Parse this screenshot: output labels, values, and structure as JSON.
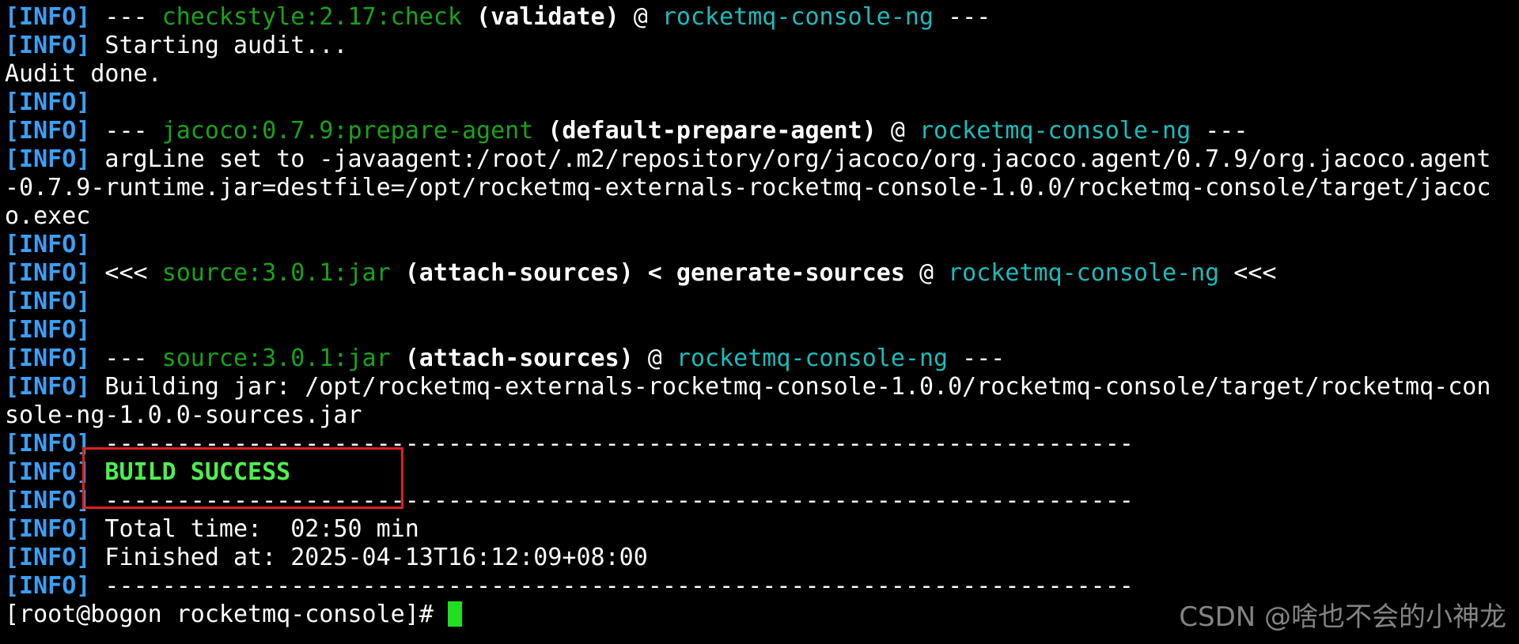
{
  "terminal": {
    "lines": [
      {
        "i": "[INFO]",
        "a": " --- ",
        "b": "checkstyle:2.17:check",
        "c": " (validate)",
        "d": " @ ",
        "e": "rocketmq-console-ng",
        "f": " ---"
      },
      {
        "i": "[INFO]",
        "t": " Starting audit..."
      },
      {
        "t": "Audit done."
      },
      {
        "i": "[INFO]"
      },
      {
        "i": "[INFO]",
        "a": " --- ",
        "b": "jacoco:0.7.9:prepare-agent",
        "c": " (default-prepare-agent)",
        "d": " @ ",
        "e": "rocketmq-console-ng",
        "f": " ---"
      },
      {
        "i": "[INFO]",
        "t": " argLine set to -javaagent:/root/.m2/repository/org/jacoco/org.jacoco.agent/0.7.9/org.jacoco.agent"
      },
      {
        "t": "-0.7.9-runtime.jar=destfile=/opt/rocketmq-externals-rocketmq-console-1.0.0/rocketmq-console/target/jacoc"
      },
      {
        "t": "o.exec"
      },
      {
        "i": "[INFO]"
      },
      {
        "i": "[INFO]",
        "a": " <<< ",
        "b": "source:3.0.1:jar",
        "c": " (attach-sources) < generate-sources",
        "d": " @ ",
        "e": "rocketmq-console-ng",
        "f": " <<<"
      },
      {
        "i": "[INFO]"
      },
      {
        "i": "[INFO]"
      },
      {
        "i": "[INFO]",
        "a": " --- ",
        "b": "source:3.0.1:jar",
        "c": " (attach-sources)",
        "d": " @ ",
        "e": "rocketmq-console-ng",
        "f": " ---"
      },
      {
        "i": "[INFO]",
        "t": " Building jar: /opt/rocketmq-externals-rocketmq-console-1.0.0/rocketmq-console/target/rocketmq-con"
      },
      {
        "t": "sole-ng-1.0.0-sources.jar"
      },
      {
        "i": "[INFO]",
        "t": " ------------------------------------------------------------------------"
      },
      {
        "i": "[INFO]",
        "s": " BUILD SUCCESS"
      },
      {
        "i": "[INFO]",
        "t": " ------------------------------------------------------------------------"
      },
      {
        "i": "[INFO]",
        "t": " Total time:  02:50 min"
      },
      {
        "i": "[INFO]",
        "t": " Finished at: 2025-04-13T16:12:09+08:00"
      },
      {
        "i": "[INFO]",
        "t": " ------------------------------------------------------------------------"
      },
      {
        "p": "[root@bogon rocketmq-console]# "
      }
    ],
    "colors": {
      "background": "#000000",
      "info": "#3aa0f8",
      "plugin": "#19a319",
      "project": "#1bbcbc",
      "success": "#4ef04e",
      "highlight": "#e0201c",
      "cursor": "#1fe01f"
    }
  },
  "watermark": "CSDN @啥也不会的小神龙"
}
